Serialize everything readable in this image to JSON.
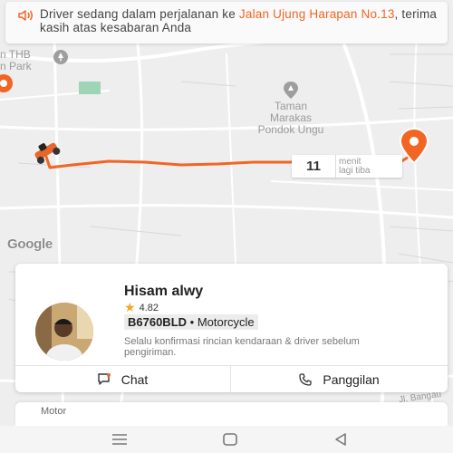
{
  "banner": {
    "text_before": "Driver sedang dalam perjalanan ke ",
    "highlight": "Jalan Ujung Harapan No.13",
    "text_after": ", terima kasih atas kesabaran Anda"
  },
  "map": {
    "labels": {
      "thb_1": "n THB",
      "thb_2": "n Park",
      "taman_1": "Taman",
      "taman_2": "Marakas",
      "taman_3": "Pondok Ungu",
      "jl_bangau": "Jl. Bangau"
    },
    "google_logo": "Google",
    "route_color": "#f26522"
  },
  "eta": {
    "minutes": "11",
    "unit_line1": "menit",
    "unit_line2": "lagi tiba"
  },
  "driver": {
    "name": "Hisam alwy",
    "rating": "4.82",
    "plate": "B6760BLD",
    "separator": " • ",
    "vehicle": "Motorcycle",
    "note": "Selalu konfirmasi rincian kendaraan & driver sebelum pengiriman."
  },
  "actions": {
    "chat_label": "Chat",
    "call_label": "Panggilan"
  },
  "service": {
    "label": "Motor"
  },
  "colors": {
    "accent": "#f26522",
    "star": "#f5a623"
  }
}
